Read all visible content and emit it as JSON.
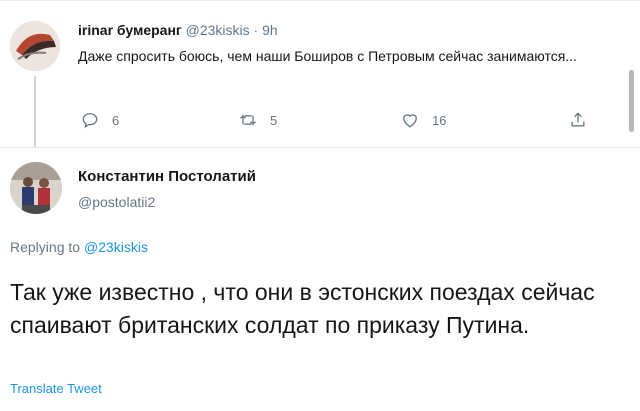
{
  "reply_tweet": {
    "display_name": "irinar бумеранг",
    "handle": "@23kiskis",
    "separator": "·",
    "time": "9h",
    "text": "Даже спросить боюсь, чем наши Боширов с Петровым сейчас занимаются...",
    "actions": {
      "reply_icon": "reply-icon",
      "reply_count": "6",
      "retweet_icon": "retweet-icon",
      "retweet_count": "5",
      "like_icon": "heart-icon",
      "like_count": "16",
      "share_icon": "share-icon"
    }
  },
  "main_tweet": {
    "display_name": "Константин Постолатий",
    "handle": "@postolatii2",
    "replying_prefix": "Replying to",
    "replying_to": "@23kiskis",
    "text": "Так уже известно , что они в эстонских поездах сейчас спаивают британских солдат по приказу Путина.",
    "translate_label": "Translate Tweet"
  },
  "colors": {
    "accent": "#1b95e0",
    "secondary_text": "#657786",
    "primary_text": "#14171a",
    "divider": "#e6ecf0"
  }
}
